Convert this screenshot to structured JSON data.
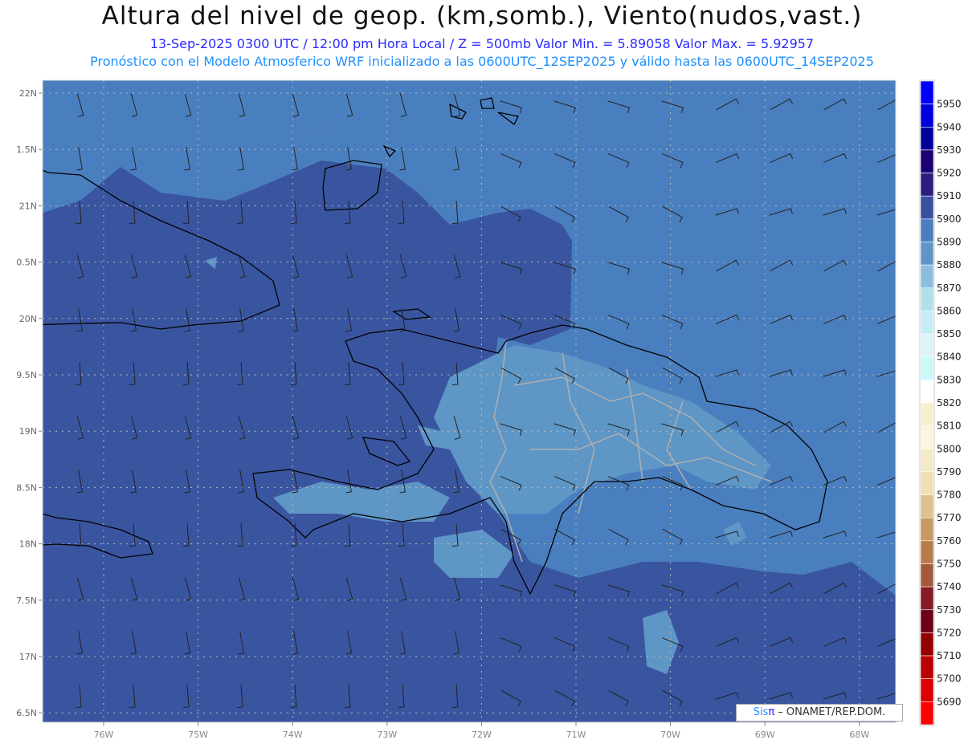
{
  "header": {
    "title": "Altura del nivel de geop. (km,somb.), Viento(nudos,vast.)",
    "subtitle1": "13-Sep-2025  0300 UTC / 12:00 pm Hora Local / Z = 500mb    Valor Min. = 5.89058   Valor Max. = 5.92957",
    "subtitle2": "Pronóstico con el Modelo Atmosferico WRF inicializado a las 0600UTC_12SEP2025 y válido hasta las  0600UTC_14SEP2025"
  },
  "map": {
    "lat_labels": [
      "22N",
      "1.5N",
      "21N",
      "0.5N",
      "20N",
      "9.5N",
      "19N",
      "8.5N",
      "18N",
      "7.5N",
      "17N",
      "6.5N"
    ],
    "lon_labels": [
      "76W",
      "75W",
      "74W",
      "73W",
      "72W",
      "71W",
      "70W",
      "69W",
      "68W"
    ],
    "fill_colors": {
      "dark": "#3a55a0",
      "medium": "#4a7fbf",
      "light": "#5e96c6"
    },
    "coast_color": "#000000",
    "border_color": "#b0b0b0"
  },
  "colorbar": {
    "labels": [
      "5950",
      "5940",
      "5930",
      "5920",
      "5910",
      "5900",
      "5890",
      "5880",
      "5870",
      "5860",
      "5850",
      "5840",
      "5830",
      "5820",
      "5810",
      "5800",
      "5790",
      "5780",
      "5770",
      "5760",
      "5750",
      "5740",
      "5730",
      "5720",
      "5710",
      "5700",
      "5690"
    ],
    "colors": [
      "#0000ff",
      "#0000dd",
      "#000099",
      "#1a0070",
      "#2a1f80",
      "#3a4f9f",
      "#4a7fbf",
      "#5e96c6",
      "#8bbedd",
      "#b3dfec",
      "#c5ecf4",
      "#ddf4f8",
      "#ccf8fa",
      "#ffffff",
      "#f8f0cc",
      "#fbf5e3",
      "#f5eac5",
      "#eedfb5",
      "#dcc18f",
      "#c89a63",
      "#b67c4c",
      "#a35a3c",
      "#851a28",
      "#6b0018",
      "#940000",
      "#bb0000",
      "#dd0000",
      "#ff0000"
    ]
  },
  "credit": {
    "sis": "Sis",
    "pi": "π",
    "text": " –  ONAMET/REP.DOM."
  }
}
